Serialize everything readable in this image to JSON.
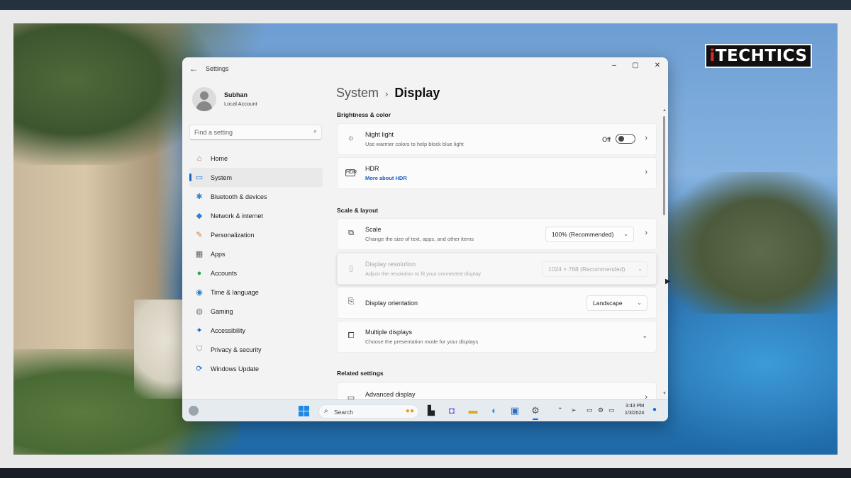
{
  "brand": {
    "logo_prefix": "i",
    "logo_text": "TECHTICS"
  },
  "window": {
    "title": "Settings",
    "controls": {
      "minimize": "–",
      "maximize": "▢",
      "close": "✕"
    }
  },
  "profile": {
    "name": "Subhan",
    "account_type": "Local Account"
  },
  "search": {
    "placeholder": "Find a setting"
  },
  "sidebar": {
    "items": [
      {
        "label": "Home",
        "icon": "home-icon",
        "color": "#c46a3a",
        "glyph": "⌂"
      },
      {
        "label": "System",
        "icon": "monitor-icon",
        "color": "#2a7fd4",
        "glyph": "▭"
      },
      {
        "label": "Bluetooth & devices",
        "icon": "bluetooth-icon",
        "color": "#2a7fd4",
        "glyph": "✱"
      },
      {
        "label": "Network & internet",
        "icon": "wifi-icon",
        "color": "#2a7fd4",
        "glyph": "◆"
      },
      {
        "label": "Personalization",
        "icon": "brush-icon",
        "color": "#d9793a",
        "glyph": "✎"
      },
      {
        "label": "Apps",
        "icon": "apps-icon",
        "color": "#666666",
        "glyph": "▦"
      },
      {
        "label": "Accounts",
        "icon": "person-icon",
        "color": "#2aa35a",
        "glyph": "●"
      },
      {
        "label": "Time & language",
        "icon": "globe-icon",
        "color": "#2a7fd4",
        "glyph": "◉"
      },
      {
        "label": "Gaming",
        "icon": "gamepad-icon",
        "color": "#777777",
        "glyph": "◍"
      },
      {
        "label": "Accessibility",
        "icon": "accessibility-icon",
        "color": "#1b66c9",
        "glyph": "✦"
      },
      {
        "label": "Privacy & security",
        "icon": "shield-icon",
        "color": "#888888",
        "glyph": "⛉"
      },
      {
        "label": "Windows Update",
        "icon": "update-icon",
        "color": "#1b66c9",
        "glyph": "⟳"
      }
    ],
    "active_index": 1
  },
  "breadcrumb": {
    "parent": "System",
    "separator": "›",
    "current": "Display"
  },
  "sections": {
    "brightness": "Brightness & color",
    "scale_layout": "Scale & layout",
    "related": "Related settings"
  },
  "cards": {
    "night_light": {
      "title": "Night light",
      "subtitle": "Use warmer colors to help block blue light",
      "toggle_state": "Off"
    },
    "hdr": {
      "title": "HDR",
      "link": "More about HDR"
    },
    "scale": {
      "title": "Scale",
      "subtitle": "Change the size of text, apps, and other items",
      "value": "100% (Recommended)"
    },
    "resolution": {
      "title": "Display resolution",
      "subtitle": "Adjust the resolution to fit your connected display",
      "value": "1024 × 768 (Recommended)"
    },
    "orientation": {
      "title": "Display orientation",
      "value": "Landscape"
    },
    "multiple": {
      "title": "Multiple displays",
      "subtitle": "Choose the presentation mode for your displays"
    },
    "advanced": {
      "title": "Advanced display"
    }
  },
  "taskbar": {
    "search_label": "Search",
    "time": "3:43 PM",
    "date": "1/3/2024"
  }
}
